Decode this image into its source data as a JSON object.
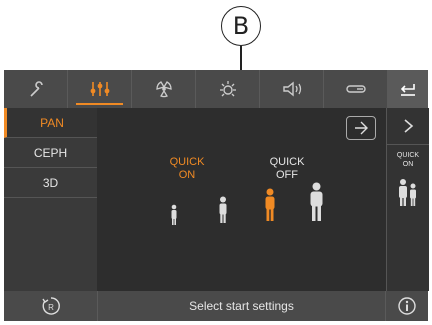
{
  "callout": {
    "label": "B"
  },
  "top_tabs": [
    {
      "name": "tools",
      "icon": "wrench-icon"
    },
    {
      "name": "settings",
      "icon": "sliders-icon",
      "active": true
    },
    {
      "name": "radiation",
      "icon": "radiation-icon"
    },
    {
      "name": "light",
      "icon": "light-icon"
    },
    {
      "name": "volume",
      "icon": "speaker-icon"
    },
    {
      "name": "key",
      "icon": "key-icon"
    }
  ],
  "back_icon": "return-icon",
  "left_menu": [
    {
      "label": "PAN",
      "active": true
    },
    {
      "label": "CEPH"
    },
    {
      "label": "3D"
    }
  ],
  "quick_on": {
    "line1": "QUICK",
    "line2": "ON"
  },
  "quick_off": {
    "line1": "QUICK",
    "line2": "OFF"
  },
  "right_panel": {
    "quick_on": {
      "line1": "QUICK",
      "line2": "ON"
    }
  },
  "status_text": "Select start settings",
  "colors": {
    "accent": "#f08a24",
    "background": "#2d2d2d",
    "bar": "#4a4a4a"
  }
}
